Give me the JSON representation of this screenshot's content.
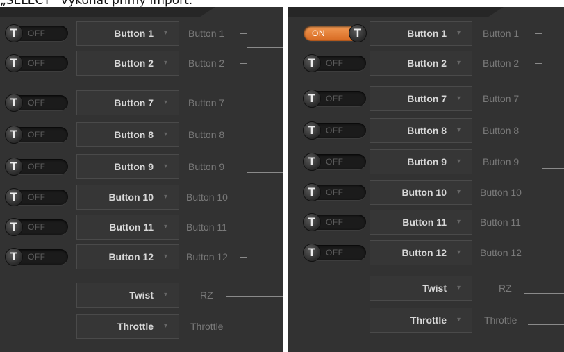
{
  "caption": "„SELECT“ Vykonat přímý import.",
  "icons": {
    "toggle_knob": "T",
    "dropdown_arrow": "▾"
  },
  "colors": {
    "on_toggle": "#e27a32",
    "panel_bg": "#323232"
  },
  "left_panel": {
    "rows": [
      {
        "toggle": "OFF",
        "button": "Button 1",
        "output": "Button 1"
      },
      {
        "toggle": "OFF",
        "button": "Button 2",
        "output": "Button 2"
      },
      {
        "toggle": "OFF",
        "button": "Button 7",
        "output": "Button 7"
      },
      {
        "toggle": "OFF",
        "button": "Button 8",
        "output": "Button 8"
      },
      {
        "toggle": "OFF",
        "button": "Button 9",
        "output": "Button 9"
      },
      {
        "toggle": "OFF",
        "button": "Button 10",
        "output": "Button 10"
      },
      {
        "toggle": "OFF",
        "button": "Button 11",
        "output": "Button 11"
      },
      {
        "toggle": "OFF",
        "button": "Button 12",
        "output": "Button 12"
      }
    ],
    "axes": [
      {
        "button": "Twist",
        "output": "RZ"
      },
      {
        "button": "Throttle",
        "output": "Throttle"
      }
    ]
  },
  "right_panel": {
    "rows": [
      {
        "toggle": "ON",
        "button": "Button 1",
        "output": "Button 1"
      },
      {
        "toggle": "OFF",
        "button": "Button 2",
        "output": "Button 2"
      },
      {
        "toggle": "OFF",
        "button": "Button 7",
        "output": "Button 7"
      },
      {
        "toggle": "OFF",
        "button": "Button 8",
        "output": "Button 8"
      },
      {
        "toggle": "OFF",
        "button": "Button 9",
        "output": "Button 9"
      },
      {
        "toggle": "OFF",
        "button": "Button 10",
        "output": "Button 10"
      },
      {
        "toggle": "OFF",
        "button": "Button 11",
        "output": "Button 11"
      },
      {
        "toggle": "OFF",
        "button": "Button 12",
        "output": "Button 12"
      }
    ],
    "axes": [
      {
        "button": "Twist",
        "output": "RZ"
      },
      {
        "button": "Throttle",
        "output": "Throttle"
      }
    ]
  }
}
